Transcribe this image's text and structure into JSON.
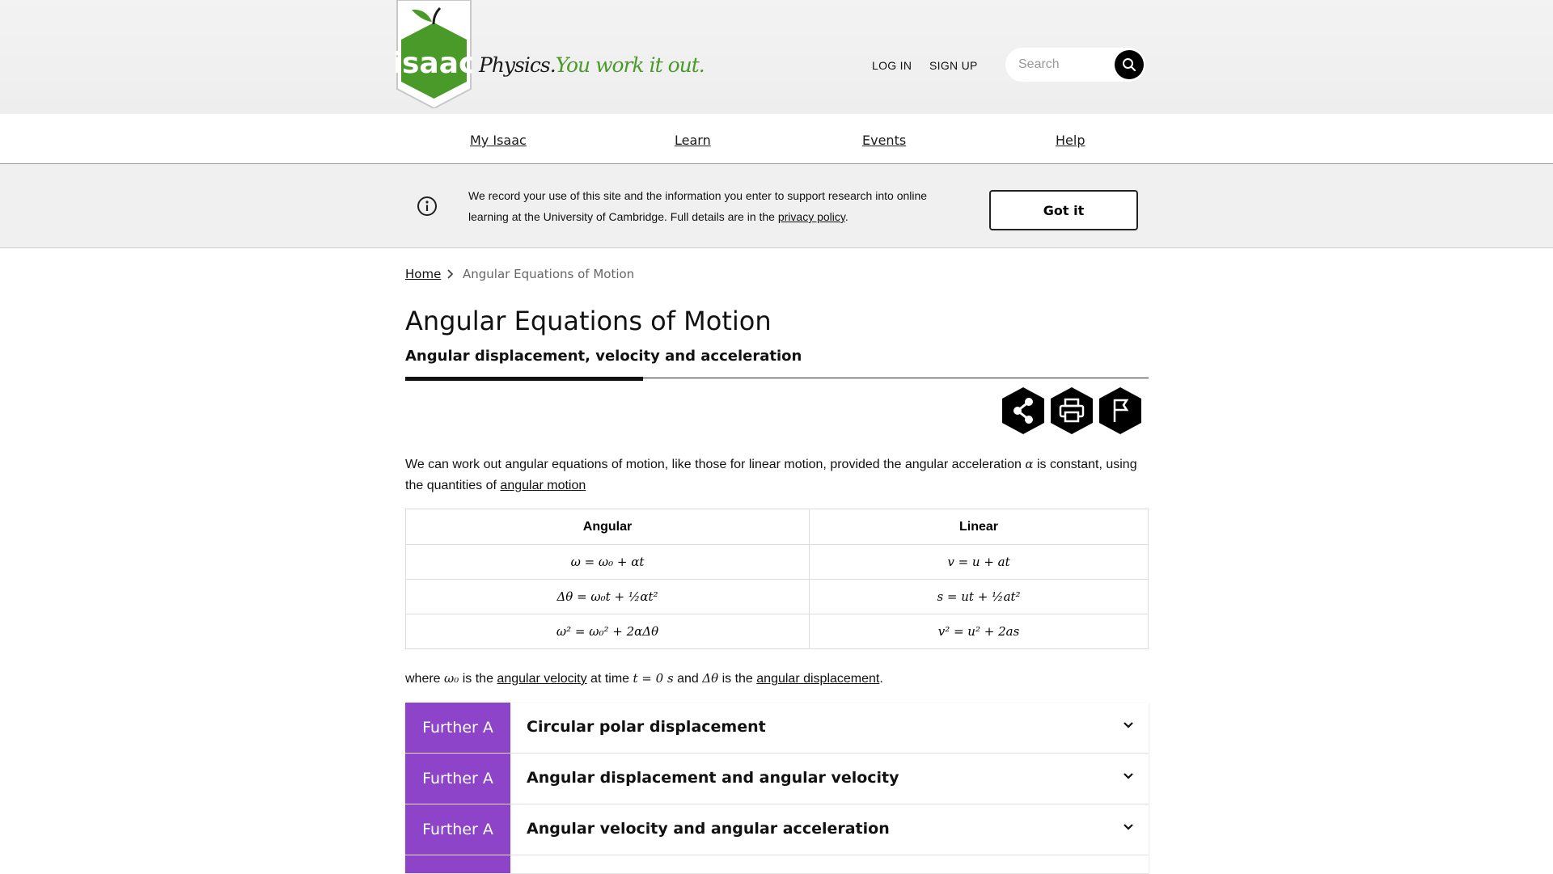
{
  "header": {
    "brand": "isaac",
    "tagline_subject": "Physics.",
    "tagline_motto": "You work it out.",
    "login_label": "LOG IN",
    "signup_label": "SIGN UP",
    "search_placeholder": "Search",
    "brand_green": "#4a9a2a"
  },
  "nav": {
    "items": [
      {
        "label": "My Isaac"
      },
      {
        "label": "Learn"
      },
      {
        "label": "Events"
      },
      {
        "label": "Help"
      }
    ]
  },
  "banner": {
    "text_before_link": "We record your use of this site and the information you enter to support research into online learning at the University of Cambridge. Full details are in the ",
    "link_text": "privacy policy",
    "text_after_link": ".",
    "button_label": "Got it"
  },
  "breadcrumb": {
    "home": "Home",
    "current": "Angular Equations of Motion"
  },
  "page": {
    "title": "Angular Equations of Motion",
    "subtitle": "Angular displacement, velocity and acceleration",
    "actions": [
      {
        "icon": "share-icon"
      },
      {
        "icon": "print-icon"
      },
      {
        "icon": "flag-icon"
      }
    ]
  },
  "intro": {
    "text1": "We can work out angular equations of motion, like those for linear motion, provided the angular acceleration ",
    "alpha": "α",
    "text2": " is constant, using the quantities of ",
    "link": "angular motion"
  },
  "table": {
    "headers": [
      "Angular",
      "Linear"
    ],
    "rows": [
      [
        "ω = ω₀ + αt",
        "v = u + at"
      ],
      [
        "Δθ = ω₀t + ½αt²",
        "s = ut + ½at²"
      ],
      [
        "ω² = ω₀² + 2αΔθ",
        "v² = u² + 2as"
      ]
    ]
  },
  "where": {
    "p1": "where ",
    "omega0": "ω₀",
    "p2": " is the ",
    "link1": "angular velocity",
    "p3": " at time ",
    "t0": "t = 0 s",
    "p4": " and ",
    "dtheta": "Δθ",
    "p5": " is the ",
    "link2": "angular displacement",
    "p6": "."
  },
  "accordions": [
    {
      "tag": "Further A",
      "title": "Circular polar displacement"
    },
    {
      "tag": "Further A",
      "title": "Angular displacement and angular velocity"
    },
    {
      "tag": "Further A",
      "title": "Angular velocity and angular acceleration"
    }
  ],
  "colors": {
    "further_a_tag": "#8e44c8"
  }
}
